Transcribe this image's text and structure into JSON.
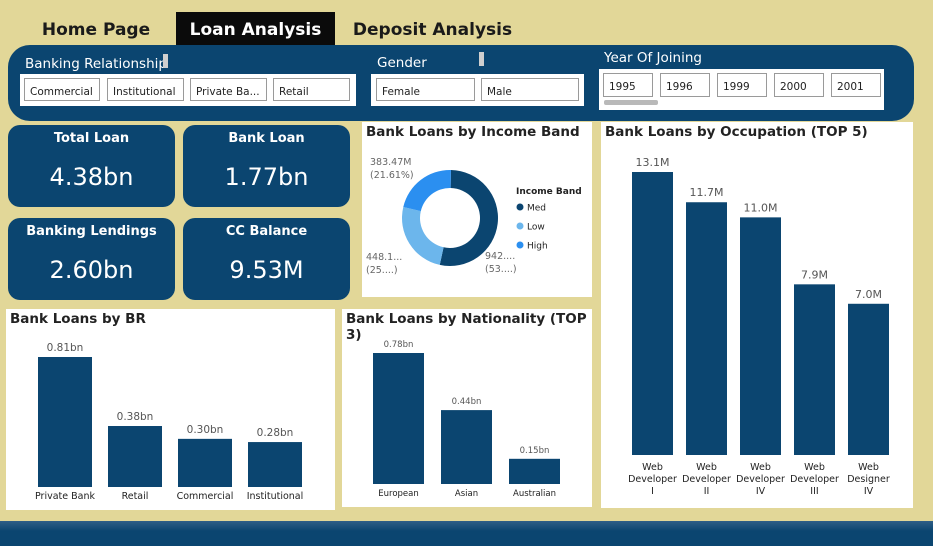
{
  "tabs": [
    {
      "label": "Home Page"
    },
    {
      "label": "Loan Analysis"
    },
    {
      "label": "Deposit Analysis"
    }
  ],
  "slicers": {
    "banking_relationship": {
      "title": "Banking Relationship",
      "options": [
        "Commercial",
        "Institutional",
        "Private Ba...",
        "Retail"
      ]
    },
    "gender": {
      "title": "Gender",
      "options": [
        "Female",
        "Male"
      ]
    },
    "year_of_joining": {
      "title": "Year Of Joining",
      "options": [
        "1995",
        "1996",
        "1999",
        "2000",
        "2001"
      ]
    }
  },
  "kpis": {
    "total_loan": {
      "label": "Total Loan",
      "value": "4.38bn"
    },
    "bank_loan": {
      "label": "Bank Loan",
      "value": "1.77bn"
    },
    "banking_lendings": {
      "label": "Banking Lendings",
      "value": "2.60bn"
    },
    "cc_balance": {
      "label": "CC Balance",
      "value": "9.53M"
    }
  },
  "chart_data": [
    {
      "id": "income_band",
      "type": "pie",
      "title": "Bank Loans by Income Band",
      "legend_title": "Income Band",
      "legend_position": "right",
      "slices": [
        {
          "name": "Med",
          "value": 942,
          "pct": 53,
          "label_value": "942....",
          "label_pct": "(53....)",
          "color": "#0b4570"
        },
        {
          "name": "Low",
          "value": 448.1,
          "pct": 25,
          "label_value": "448.1...",
          "label_pct": "(25....)",
          "color": "#6cb6ec"
        },
        {
          "name": "High",
          "value": 383.47,
          "pct": 21.61,
          "label_value": "383.47M",
          "label_pct": "(21.61%)",
          "color": "#2b8ff0"
        }
      ]
    },
    {
      "id": "occupation",
      "type": "bar",
      "title": "Bank Loans by Occupation (TOP 5)",
      "categories": [
        "Web Developer I",
        "Web Developer II",
        "Web Developer IV",
        "Web Developer III",
        "Web Designer IV"
      ],
      "category_lines": [
        [
          "Web",
          "Developer",
          "I"
        ],
        [
          "Web",
          "Developer",
          "II"
        ],
        [
          "Web",
          "Developer",
          "IV"
        ],
        [
          "Web",
          "Developer",
          "III"
        ],
        [
          "Web",
          "Designer",
          "IV"
        ]
      ],
      "values": [
        13.1,
        11.7,
        11.0,
        7.9,
        7.0
      ],
      "data_labels": [
        "13.1M",
        "11.7M",
        "11.0M",
        "7.9M",
        "7.0M"
      ],
      "unit": "M",
      "ylim": [
        0,
        13.1
      ],
      "color": "#0b4570"
    },
    {
      "id": "br",
      "type": "bar",
      "title": "Bank Loans by BR",
      "categories": [
        "Private Bank",
        "Retail",
        "Commercial",
        "Institutional"
      ],
      "values": [
        0.81,
        0.38,
        0.3,
        0.28
      ],
      "data_labels": [
        "0.81bn",
        "0.38bn",
        "0.30bn",
        "0.28bn"
      ],
      "unit": "bn",
      "ylim": [
        0,
        0.81
      ],
      "color": "#0b4570"
    },
    {
      "id": "nationality",
      "type": "bar",
      "title": "Bank Loans by Nationality (TOP 3)",
      "categories": [
        "European",
        "Asian",
        "Australian"
      ],
      "values": [
        0.78,
        0.44,
        0.15
      ],
      "data_labels": [
        "0.78bn",
        "0.44bn",
        "0.15bn"
      ],
      "unit": "bn",
      "ylim": [
        0,
        0.78
      ],
      "color": "#0b4570"
    }
  ]
}
